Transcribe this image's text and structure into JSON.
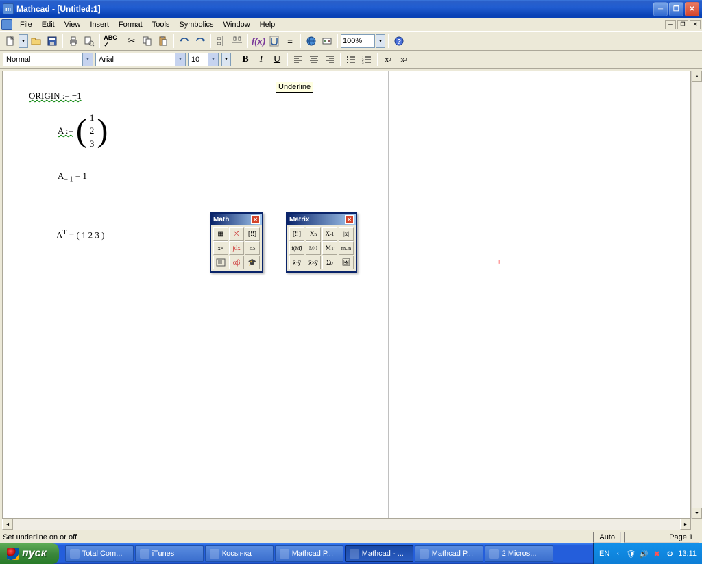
{
  "titlebar": {
    "title": "Mathcad - [Untitled:1]"
  },
  "menubar": {
    "items": [
      "File",
      "Edit",
      "View",
      "Insert",
      "Format",
      "Tools",
      "Symbolics",
      "Window",
      "Help"
    ]
  },
  "toolbar": {
    "zoom": "100%"
  },
  "formatbar": {
    "style": "Normal",
    "font": "Arial",
    "size": "10"
  },
  "tooltip": {
    "text": "Underline"
  },
  "math": {
    "origin": "ORIGIN := −1",
    "a_def_lhs": "A :=",
    "a_def_vals": [
      "1",
      "2",
      "3"
    ],
    "a_sub": "A",
    "a_sub_idx": "− 1",
    "a_sub_rhs": " = 1",
    "a_t": "A",
    "a_t_sup": "T",
    "a_t_rhs": " = ( 1  2  3 )"
  },
  "palettes": {
    "math": {
      "title": "Math"
    },
    "matrix": {
      "title": "Matrix"
    }
  },
  "statusbar": {
    "hint": "Set underline on or off",
    "auto": "Auto",
    "page": "Page 1"
  },
  "taskbar": {
    "start": "пуск",
    "tasks": [
      "Total Com...",
      "iTunes",
      "Косынка",
      "Mathcad P...",
      "Mathcad - ...",
      "Mathcad P...",
      "2 Micros..."
    ],
    "lang": "EN",
    "time": "13:11"
  }
}
